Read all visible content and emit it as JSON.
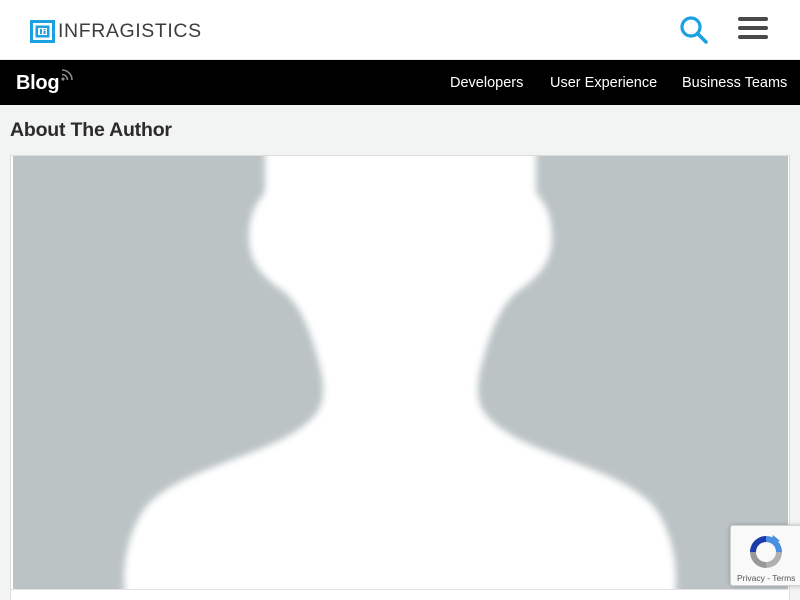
{
  "header": {
    "logo_text": "INFRAGISTICS",
    "search_icon": "search-icon",
    "menu_icon": "hamburger-menu-icon",
    "accent_color": "#1ba1e2"
  },
  "nav": {
    "blog_label": "Blog",
    "rss_icon": "rss-icon",
    "links": [
      "Developers",
      "User Experience",
      "Business Teams"
    ]
  },
  "main": {
    "section_title": "About The Author",
    "avatar_icon": "default-user-silhouette"
  },
  "recaptcha": {
    "privacy_label": "Privacy",
    "separator": " - ",
    "terms_label": "Terms"
  }
}
